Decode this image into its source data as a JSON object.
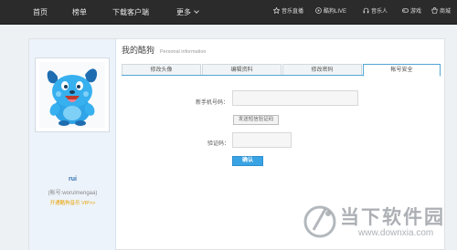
{
  "topnav": {
    "items": [
      {
        "label": "首页"
      },
      {
        "label": "榜单"
      },
      {
        "label": "下载客户端"
      },
      {
        "label": "更多"
      }
    ],
    "right": [
      {
        "label": "音乐直播",
        "icon": "star-icon"
      },
      {
        "label": "酷狗LIVE",
        "icon": "play-icon"
      },
      {
        "label": "音乐人",
        "icon": "headphones-icon"
      },
      {
        "label": "游戏",
        "icon": "gamepad-icon"
      },
      {
        "label": "商城",
        "icon": "shop-icon"
      }
    ]
  },
  "profile": {
    "username": "rui",
    "account": "(帐号:worulmengaa)",
    "vip": "开通酷狗音乐 VIP>>"
  },
  "main": {
    "title": "我的酷狗",
    "subtitle": "Personal information",
    "tabs": [
      {
        "label": "修改头像"
      },
      {
        "label": "编辑资料"
      },
      {
        "label": "修改密码"
      },
      {
        "label": "帐号安全"
      }
    ],
    "active_tab": 3
  },
  "form": {
    "phone_label": "新手机号码：",
    "send_code_label": "发送短信验证码",
    "code_label": "验证码：",
    "confirm_label": "确认"
  },
  "watermark": {
    "cn": "当下软件园",
    "en": "www.downxia.com"
  },
  "colors": {
    "topbar": "#2b2b2b",
    "accent": "#3aa3e3",
    "vip": "#e8a200"
  }
}
